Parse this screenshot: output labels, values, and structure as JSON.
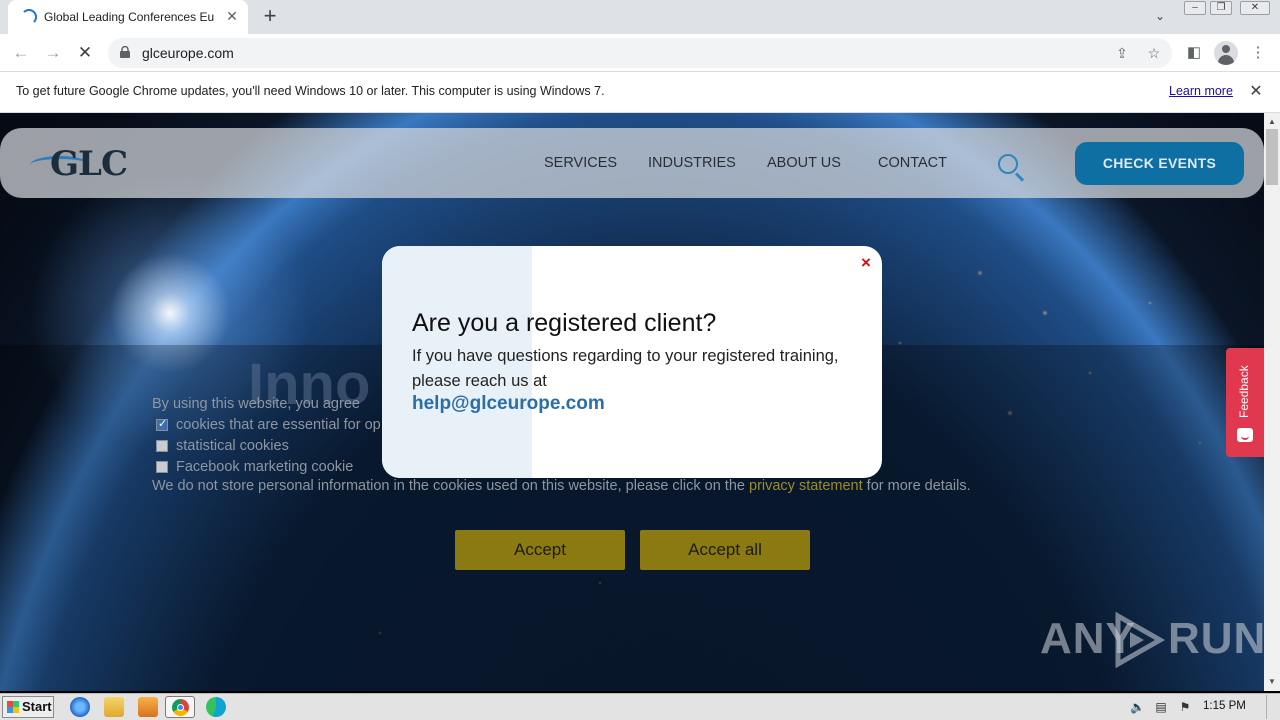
{
  "browser": {
    "tab_title": "Global Leading Conferences Europe",
    "tab_close": "✕",
    "new_tab": "+",
    "url": "glceurope.com",
    "infobar_text": "To get future Google Chrome updates, you'll need Windows 10 or later. This computer is using Windows 7.",
    "infobar_link": "Learn more",
    "infobar_close": "✕"
  },
  "site": {
    "logo_text": "GLC",
    "nav": [
      "SERVICES",
      "INDUSTRIES",
      "ABOUT US",
      "CONTACT"
    ],
    "cta": "CHECK EVENTS",
    "hero_ghost": "Inno",
    "feedback": "Feedback"
  },
  "cookie": {
    "intro": "By using this website, you agree",
    "options": [
      {
        "label": "cookies that are essential for op",
        "checked": true
      },
      {
        "label": "statistical cookies",
        "checked": false
      },
      {
        "label": "Facebook marketing cookie",
        "checked": false
      }
    ],
    "note_before": "We do not store personal information in the cookies used on this website, please click on the ",
    "note_link": "privacy statement",
    "note_after": " for more details.",
    "accept": "Accept",
    "accept_all": "Accept all"
  },
  "modal": {
    "close": "×",
    "title": "Are you a registered client?",
    "body": "If you have questions regarding to your registered training, please reach us at",
    "email": "help@glceurope.com"
  },
  "watermark": {
    "left": "ANY",
    "right": "RUN"
  },
  "taskbar": {
    "start": "Start",
    "clock": "1:15 PM"
  },
  "colors": {
    "cta": "#0e6fa3",
    "cookie_button": "#8b7a12",
    "feedback": "#e0394f",
    "modal_email": "#2a6ea8",
    "modal_close": "#d01010"
  }
}
